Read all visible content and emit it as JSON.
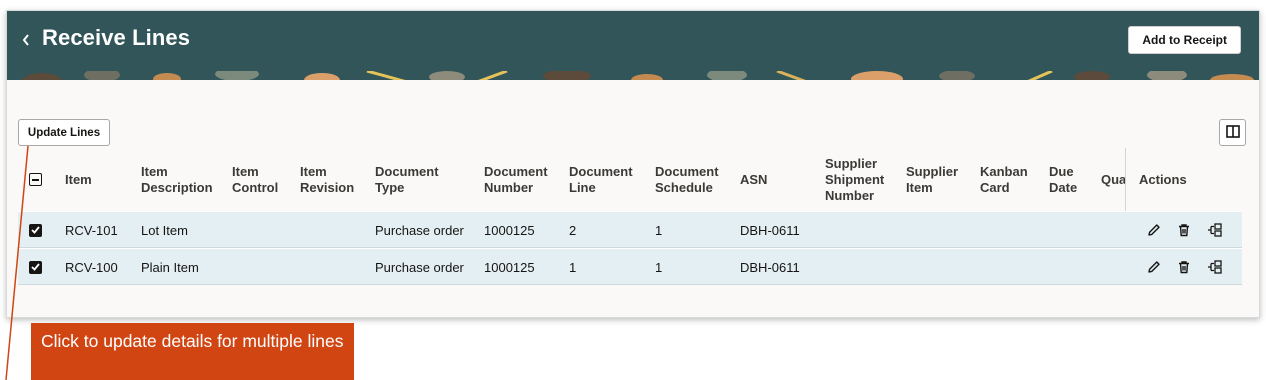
{
  "header": {
    "title": "Receive Lines",
    "add_button": "Add to Receipt"
  },
  "toolbar": {
    "update_lines": "Update Lines"
  },
  "table": {
    "columns": [
      [
        "Item"
      ],
      [
        "Item",
        "Description"
      ],
      [
        "Item",
        "Control"
      ],
      [
        "Item",
        "Revision"
      ],
      [
        "Document",
        "Type"
      ],
      [
        "Document",
        "Number"
      ],
      [
        "Document",
        "Line"
      ],
      [
        "Document",
        "Schedule"
      ],
      [
        "ASN"
      ],
      [
        "Supplier",
        "Shipment",
        "Number"
      ],
      [
        "Supplier",
        "Item"
      ],
      [
        "Kanban",
        "Card"
      ],
      [
        "Due",
        "Date"
      ],
      [
        "Qua"
      ]
    ],
    "actions_header": "Actions",
    "rows": [
      {
        "item": "RCV-101",
        "description": "Lot Item",
        "doc_type": "Purchase order",
        "doc_number": "1000125",
        "doc_line": "2",
        "doc_schedule": "1",
        "asn": "DBH-0611"
      },
      {
        "item": "RCV-100",
        "description": "Plain Item",
        "doc_type": "Purchase order",
        "doc_number": "1000125",
        "doc_line": "1",
        "doc_schedule": "1",
        "asn": "DBH-0611"
      }
    ]
  },
  "callout": {
    "text": "Click to update details for multiple lines"
  },
  "colors": {
    "header_bg": "#315559",
    "row_selected": "#e4eff3",
    "callout_bg": "#d14513"
  }
}
